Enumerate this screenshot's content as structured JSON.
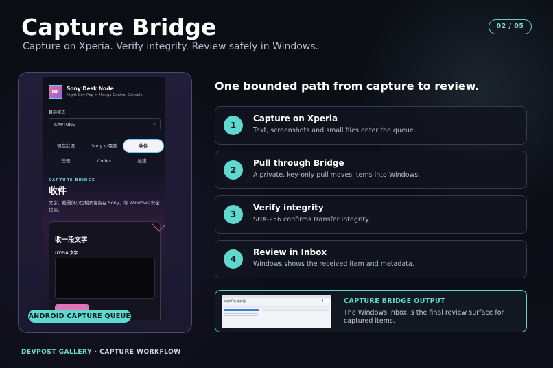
{
  "header": {
    "title": "Capture Bridge",
    "subtitle": "Capture on Xperia. Verify integrity. Review safely in Windows.",
    "page_indicator": "02 / 05"
  },
  "phone": {
    "logo_text": "NC",
    "app_name": "Sony Desk Node",
    "app_tagline": "Night City Pop × Manga Control Console",
    "mode_label": "目前模式",
    "mode_value": "CAPTURE",
    "tabs": [
      {
        "label": "現在狀況"
      },
      {
        "label": "Sony 小電腦"
      },
      {
        "label": "收件"
      },
      {
        "label": "任務"
      },
      {
        "label": "Codex"
      },
      {
        "label": "維護"
      }
    ],
    "section_eyebrow": "CAPTURE BRIDGE",
    "section_heading": "收件",
    "section_desc": "文字、截圖與小型檔案會留在 Sony，等 Windows 安全拉取。",
    "card_title": "收一段文字",
    "card_field_label": "UTF-8 文字"
  },
  "queue_pill": "ANDROID CAPTURE QUEUE",
  "footer": {
    "brand": "DEVPOST GALLERY",
    "separator": "·",
    "label": "CAPTURE WORKFLOW"
  },
  "path_heading": "One bounded path from capture to review.",
  "steps": [
    {
      "number": "1",
      "title": "Capture on Xperia",
      "desc": "Text, screenshots and small files enter the queue."
    },
    {
      "number": "2",
      "title": "Pull through Bridge",
      "desc": "A private, key-only pull moves items into Windows."
    },
    {
      "number": "3",
      "title": "Verify integrity",
      "desc": "SHA-256 confirms transfer integrity."
    },
    {
      "number": "4",
      "title": "Review in Inbox",
      "desc": "Windows shows the received item and metadata."
    }
  ],
  "output": {
    "eyebrow": "CAPTURE BRIDGE OUTPUT",
    "desc": "The Windows Inbox is the final review surface for captured items.",
    "thumb_title": "NightCity 收件匣"
  },
  "colors": {
    "accent": "#5fd9cd",
    "pink": "#e075b6",
    "background": "#0b0d14"
  }
}
